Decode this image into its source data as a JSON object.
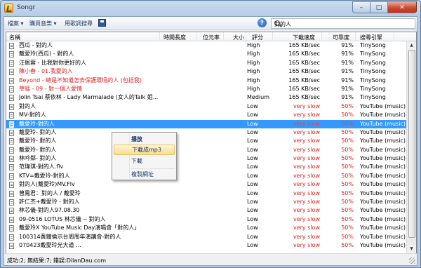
{
  "window": {
    "title": "Songr",
    "minimize": "–",
    "maximize": "□",
    "close": "✕"
  },
  "toolbar": {
    "file_menu": "檔案 ▾",
    "buy_music_menu": "購買音樂 ▾",
    "lyrics_search_menu": "用歌詞搜尋",
    "help_icon": "?",
    "search_value": "對的人"
  },
  "columns": {
    "name": "名稱",
    "duration": "時間長度",
    "bitrate": "位元率",
    "size": "大小",
    "score": "評分",
    "speed": "下載速度",
    "reliability": "可靠度",
    "engine": "搜尋引擎"
  },
  "rows": [
    {
      "name": "西瓜 - 對的人",
      "score": "High",
      "speed": "165 KB/sec",
      "pct": "91%",
      "engine": "TinySong",
      "red_name": false,
      "slow": false
    },
    {
      "name": "戴愛玲(西瓜) - 對的人",
      "score": "High",
      "speed": "165 KB/sec",
      "pct": "91%",
      "engine": "TinySong",
      "red_name": false,
      "slow": false
    },
    {
      "name": "汪佩蓉 - 比我對你更好的人",
      "score": "High",
      "speed": "165 KB/sec",
      "pct": "91%",
      "engine": "TinySong",
      "red_name": false,
      "slow": false
    },
    {
      "name": "陳小春 - 01.我愛的人",
      "score": "High",
      "speed": "165 KB/sec",
      "pct": "91%",
      "engine": "TinySong",
      "red_name": true,
      "slow": false
    },
    {
      "name": "Beyond - 總是不知道怎去保護環境的人 (包括我)",
      "score": "High",
      "speed": "165 KB/sec",
      "pct": "91%",
      "engine": "TinySong",
      "red_name": true,
      "slow": false
    },
    {
      "name": "草蜢 - 09 - 對一個人愛情",
      "score": "High",
      "speed": "165 KB/sec",
      "pct": "91%",
      "engine": "TinySong",
      "red_name": true,
      "slow": false
    },
    {
      "name": "Jolin Tsai 蔡依林 - Lady Marmalade (女人的Talk 姐...",
      "score": "Medium",
      "speed": "165 KB/sec",
      "pct": "91%",
      "engine": "TinySong",
      "red_name": false,
      "slow": false
    },
    {
      "name": "對的人",
      "score": "Low",
      "speed": "very slow",
      "pct": "50%",
      "engine": "YouTube (music)",
      "red_name": false,
      "slow": true
    },
    {
      "name": "MV-對的人",
      "score": "Low",
      "speed": "very slow",
      "pct": "50%",
      "engine": "YouTube (music)",
      "red_name": false,
      "slow": true
    },
    {
      "name": "戴愛玲-對的人",
      "score": "Low",
      "speed": "very slow",
      "pct": "50%",
      "engine": "YouTube (music)",
      "red_name": false,
      "slow": true,
      "selected": true
    },
    {
      "name": "戴愛玲- 對的人",
      "score": "Low",
      "speed": "very slow",
      "pct": "50%",
      "engine": "YouTube (music)",
      "red_name": false,
      "slow": true
    },
    {
      "name": "戴愛玲- 對的人",
      "score": "Low",
      "speed": "very slow",
      "pct": "50%",
      "engine": "YouTube (music)",
      "red_name": false,
      "slow": true
    },
    {
      "name": "戴愛玲- 對的人",
      "score": "Low",
      "speed": "very slow",
      "pct": "50%",
      "engine": "YouTube (music)",
      "red_name": false,
      "slow": true
    },
    {
      "name": "林吟鄰- 對的人",
      "score": "Low",
      "speed": "very slow",
      "pct": "50%",
      "engine": "YouTube (music)",
      "red_name": false,
      "slow": true
    },
    {
      "name": "范瑋琪-對的人.flv",
      "score": "Low",
      "speed": "very slow",
      "pct": "50%",
      "engine": "YouTube (music)",
      "red_name": false,
      "slow": true
    },
    {
      "name": "KTV=戴愛玲-對的人",
      "score": "Low",
      "speed": "very slow",
      "pct": "50%",
      "engine": "YouTube (music)",
      "red_name": false,
      "slow": true
    },
    {
      "name": "對的人(戴愛玲)MV.Flv",
      "score": "Low",
      "speed": "very slow",
      "pct": "50%",
      "engine": "YouTube (music)",
      "red_name": false,
      "slow": true
    },
    {
      "name": "曾鳳君：對的人 / 戴愛玲",
      "score": "Low",
      "speed": "very slow",
      "pct": "50%",
      "engine": "YouTube (music)",
      "red_name": false,
      "slow": true
    },
    {
      "name": "許仁杰+戴愛玲 - 對的人",
      "score": "Low",
      "speed": "very slow",
      "pct": "50%",
      "engine": "YouTube (music)",
      "red_name": false,
      "slow": true
    },
    {
      "name": "林芯儀-對的人97.08.30",
      "score": "Low",
      "speed": "very slow",
      "pct": "50%",
      "engine": "YouTube (music)",
      "red_name": false,
      "slow": true
    },
    {
      "name": "09-0516 LOTUS 林芯儀 -- 對的人",
      "score": "Low",
      "speed": "very slow",
      "pct": "50%",
      "engine": "YouTube (music)",
      "red_name": false,
      "slow": true
    },
    {
      "name": "戴愛玲X YouTube Music Day演唱會「對的人」",
      "score": "Low",
      "speed": "very slow",
      "pct": "50%",
      "engine": "YouTube (music)",
      "red_name": false,
      "slow": true
    },
    {
      "name": "100314黃鐘倫示台周周年演講會-對的人",
      "score": "Low",
      "speed": "very slow",
      "pct": "50%",
      "engine": "YouTube (music)",
      "red_name": false,
      "slow": true
    },
    {
      "name": "070423戴愛玲光大道 ...",
      "score": "Low",
      "speed": "very slow",
      "pct": "50%",
      "engine": "YouTube (music)",
      "red_name": false,
      "slow": true
    }
  ],
  "context_menu": {
    "play": "播放",
    "download_mp3": "下載成mp3",
    "download": "下載",
    "copy_url": "複製網址"
  },
  "status": {
    "text": "成功:2; 無結果:7; 錯誤:DilanDau.com"
  }
}
